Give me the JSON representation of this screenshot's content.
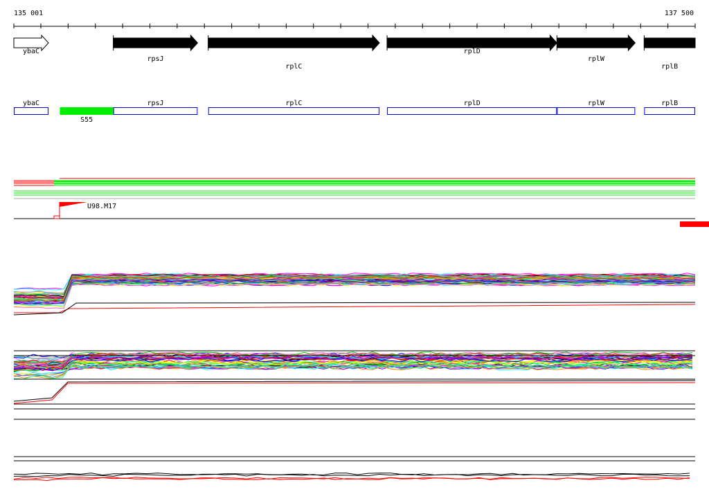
{
  "ruler": {
    "start_label": "135 001",
    "end_label": "137 500",
    "start": 135001,
    "end": 137500,
    "tick_step": 100
  },
  "genes": [
    {
      "name": "ybaC",
      "start": 135001,
      "end": 135128,
      "style": "outline",
      "label_row": 0
    },
    {
      "name": "rpsJ",
      "start": 135366,
      "end": 135675,
      "style": "filled",
      "label_row": 1
    },
    {
      "name": "rplC",
      "start": 135714,
      "end": 136342,
      "style": "filled",
      "label_row": 2
    },
    {
      "name": "rplD",
      "start": 136370,
      "end": 136993,
      "style": "filled",
      "label_row": 0
    },
    {
      "name": "rplW",
      "start": 136993,
      "end": 137280,
      "style": "filled",
      "label_row": 1
    },
    {
      "name": "rplB",
      "start": 137313,
      "end": 137500,
      "style": "filled-noarrow",
      "label_row": 2
    }
  ],
  "features": [
    {
      "name": "ybaC",
      "start": 135001,
      "end": 135128
    },
    {
      "name": "rpsJ",
      "start": 135366,
      "end": 135675
    },
    {
      "name": "rplC",
      "start": 135714,
      "end": 136342
    },
    {
      "name": "rplD",
      "start": 136370,
      "end": 136993
    },
    {
      "name": "rplW",
      "start": 136993,
      "end": 137280
    },
    {
      "name": "rplB",
      "start": 137313,
      "end": 137500
    }
  ],
  "highlight": {
    "name": "S55",
    "start": 135170,
    "end": 135366,
    "color": "#00ee00"
  },
  "peak": {
    "label": "U98.M17",
    "color": "#ff0000"
  },
  "colors": {
    "feature_outline": "#0000dd",
    "red": "#ff0000",
    "green": "#00ee00",
    "black": "#000000",
    "gray": "#888888",
    "palette": [
      "#ff00ff",
      "#00ffff",
      "#ff8800",
      "#00cc00",
      "#0000ff",
      "#ffff00",
      "#ff0000",
      "#888888",
      "#8800ff",
      "#00ff88",
      "#aa5500",
      "#ff66cc",
      "#66ccff",
      "#000000"
    ]
  }
}
